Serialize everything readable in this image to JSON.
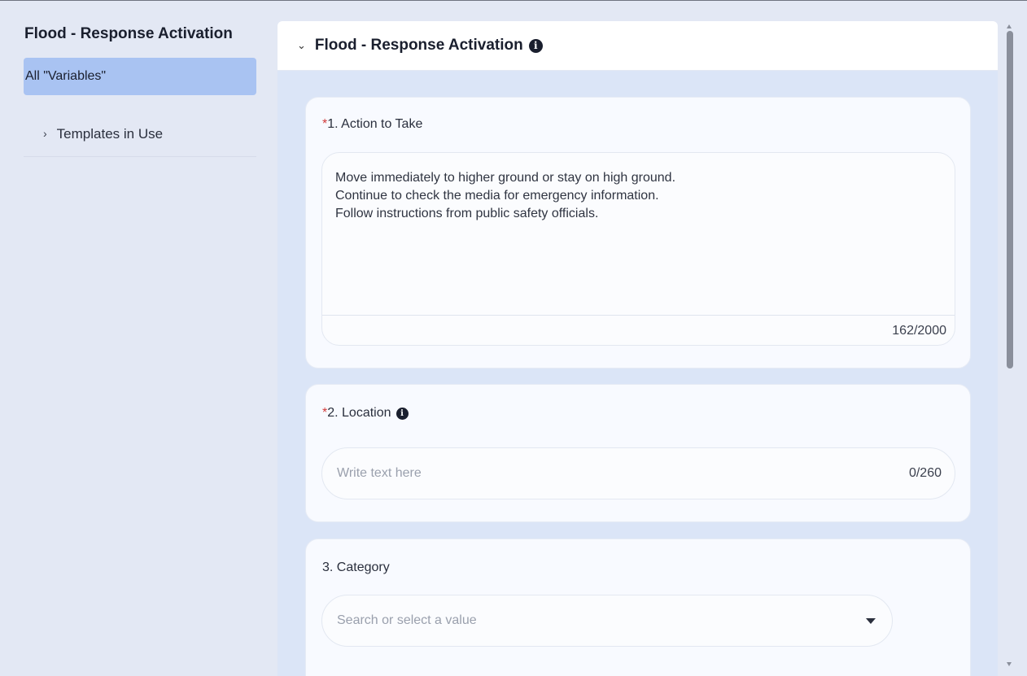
{
  "sidebar": {
    "title": "Flood - Response Activation",
    "active_item": "All \"Variables\"",
    "tree_item": "Templates in Use"
  },
  "panel": {
    "title": "Flood - Response Activation"
  },
  "fields": [
    {
      "required": "*",
      "label": "1. Action to Take",
      "value": "Move immediately to higher ground or stay on high ground.\nContinue to check the media for emergency information.\nFollow instructions from public safety officials.",
      "counter": "162/2000"
    },
    {
      "required": "*",
      "label": "2. Location",
      "placeholder": "Write text here",
      "counter": "0/260"
    },
    {
      "label": "3. Category",
      "placeholder": "Search or select a value"
    }
  ],
  "colors": {
    "accent": "#a9c3f2",
    "required": "#d23b3b"
  }
}
